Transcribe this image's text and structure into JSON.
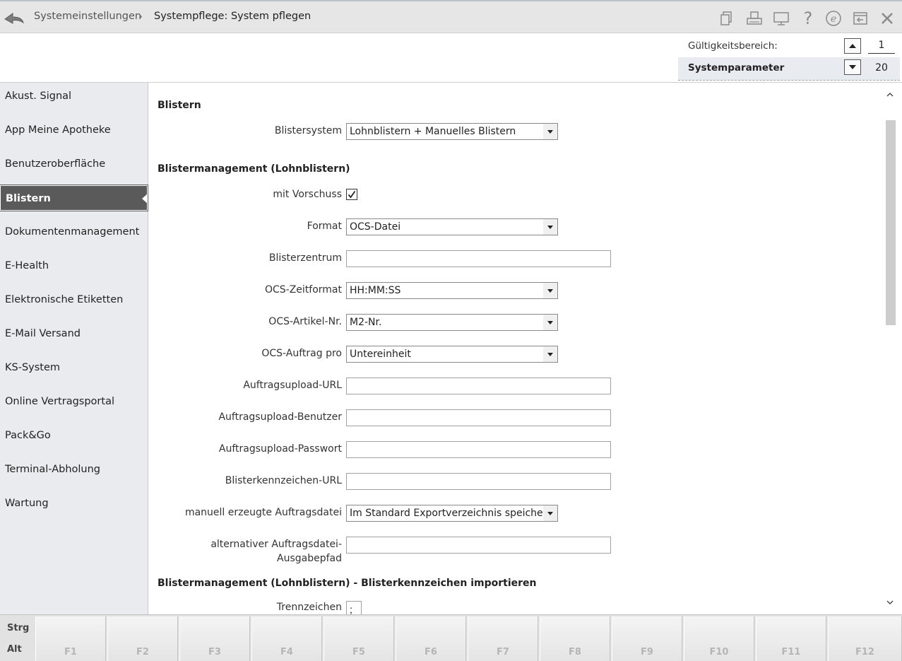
{
  "titlebar": {
    "breadcrumb_parent": "Systemeinstellungen",
    "breadcrumb_separator": "›",
    "breadcrumb_current": "Systempflege: System pflegen",
    "icons": [
      "copy-icon",
      "print-icon",
      "monitor-icon",
      "help-icon",
      "e-icon",
      "window-exit-icon",
      "close-icon"
    ]
  },
  "header": {
    "validity_label": "Gültigkeitsbereich:",
    "system_label": "Systemparameter",
    "page_current": "1",
    "page_total": "20"
  },
  "sidebar": {
    "items": [
      {
        "label": "Akust. Signal"
      },
      {
        "label": "App Meine Apotheke"
      },
      {
        "label": "Benutzeroberfläche"
      },
      {
        "label": "Blistern"
      },
      {
        "label": "Dokumentenmanagement"
      },
      {
        "label": "E-Health"
      },
      {
        "label": "Elektronische Etiketten"
      },
      {
        "label": "E-Mail Versand"
      },
      {
        "label": "KS-System"
      },
      {
        "label": "Online Vertragsportal"
      },
      {
        "label": "Pack&Go"
      },
      {
        "label": "Terminal-Abholung"
      },
      {
        "label": "Wartung"
      }
    ],
    "active": "Blistern"
  },
  "content": {
    "section1_title": "Blistern",
    "blistersystem_label": "Blistersystem",
    "blistersystem_value": "Lohnblistern + Manuelles Blistern",
    "section2_title": "Blistermanagement (Lohnblistern)",
    "vorschuss_label": "mit Vorschuss",
    "vorschuss_checked": true,
    "format_label": "Format",
    "format_value": "OCS-Datei",
    "blisterzentrum_label": "Blisterzentrum",
    "blisterzentrum_value": "",
    "zeitformat_label": "OCS-Zeitformat",
    "zeitformat_value": "HH:MM:SS",
    "artikelnr_label": "OCS-Artikel-Nr.",
    "artikelnr_value": "M2-Nr.",
    "auftrag_label": "OCS-Auftrag pro",
    "auftrag_value": "Untereinheit",
    "upload_url_label": "Auftragsupload-URL",
    "upload_url_value": "",
    "upload_user_label": "Auftragsupload-Benutzer",
    "upload_user_value": "",
    "upload_pw_label": "Auftragsupload-Passwort",
    "upload_pw_value": "",
    "kennzeichen_url_label": "Blisterkennzeichen-URL",
    "kennzeichen_url_value": "",
    "manuell_label": "manuell erzeugte Auftragsdatei",
    "manuell_value": "Im Standard Exportverzeichnis speichern",
    "alt_pfad_label_line1": "alternativer Auftragsdatei-",
    "alt_pfad_label_line2": "Ausgabepfad",
    "alt_pfad_value": "",
    "section3_title": "Blistermanagement (Lohnblistern) - Blisterkennzeichen importieren",
    "trennzeichen_label": "Trennzeichen",
    "trennzeichen_value": ";"
  },
  "fkeys": {
    "mod_top": "Strg",
    "mod_bottom": "Alt",
    "keys": [
      "F1",
      "F2",
      "F3",
      "F4",
      "F5",
      "F6",
      "F7",
      "F8",
      "F9",
      "F10",
      "F11",
      "F12"
    ]
  }
}
